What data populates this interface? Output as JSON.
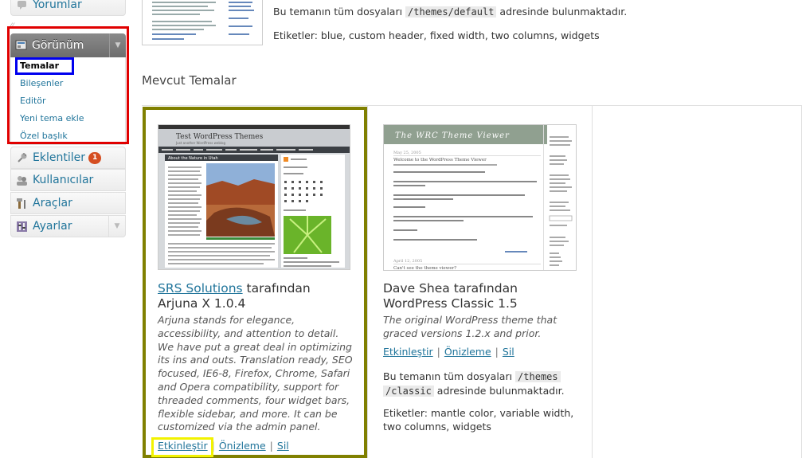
{
  "sidebar": {
    "comments": "Yorumlar",
    "appearance": {
      "label": "Görünüm",
      "items": [
        "Temalar",
        "Bileşenler",
        "Editör",
        "Yeni tema ekle",
        "Özel başlık"
      ]
    },
    "plugins": {
      "label": "Eklentiler",
      "badge": "1"
    },
    "users": "Kullanıcılar",
    "tools": "Araçlar",
    "settings": "Ayarlar"
  },
  "current_theme": {
    "files_prefix": "Bu temanın tüm dosyaları",
    "files_path": "/themes/default",
    "files_suffix": "adresinde bulunmaktadır.",
    "tags": "Etiketler: blue, custom header, fixed width, two columns, widgets"
  },
  "section_title": "Mevcut Temalar",
  "themes": [
    {
      "author": "SRS Solutions",
      "by": "tarafından",
      "name": "Arjuna X 1.0.4",
      "description": "Arjuna stands for elegance, accessibility, and attention to detail. We have put a great deal in optimizing its ins and outs. Translation ready, SEO focused, IE6-8, Firefox, Chrome, Safari and Opera compatibility, support for threaded comments, four widget bars, flexible sidebar, and more. It can be customized via the admin panel.",
      "actions": [
        "Etkinleştir",
        "Önizleme",
        "Sil"
      ],
      "screenshot": {
        "site_title": "Test WordPress Themes",
        "tagline": "Just another WordPress weblog",
        "post_title": "About the Nature in Utah"
      }
    },
    {
      "author": "Dave Shea",
      "by": "tarafından",
      "name": "WordPress Classic 1.5",
      "description": "The original WordPress theme that graced versions 1.2.x and prior.",
      "actions": [
        "Etkinleştir",
        "Önizleme",
        "Sil"
      ],
      "files_prefix": "Bu temanın tüm dosyaları",
      "files_path_1": "/themes",
      "files_path_2": "/classic",
      "files_suffix": "adresinde bulunmaktadır.",
      "tags": "Etiketler: mantle color, variable width, two columns, widgets",
      "screenshot": {
        "header": "The WRC Theme Viewer",
        "date1": "May 25, 2005",
        "post1": "Welcome to the WordPress Theme Viewer",
        "date2": "April 12, 2005",
        "post2": "Can't see the theme viewer?"
      }
    }
  ],
  "colors": {
    "highlight_red": "#e00000",
    "highlight_blue": "#0000ee",
    "highlight_olive": "#808000",
    "highlight_yellow": "#f2f200",
    "link": "#21759b"
  }
}
